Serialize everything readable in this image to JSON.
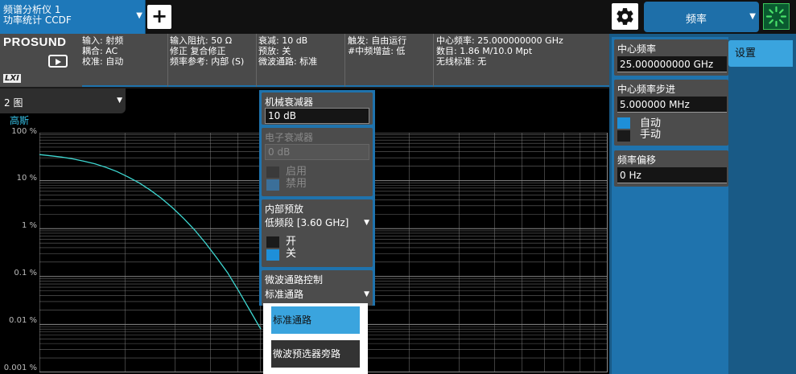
{
  "top_bar": {
    "app_tab": {
      "line1": "频谱分析仪 1",
      "line2": "功率统计 CCDF"
    },
    "add_button_label": "+",
    "frequency_menu_label": "频率"
  },
  "info": {
    "brand": "PROSUND",
    "lxi": "LXI",
    "col1": [
      "输入: 射频",
      "耦合: AC",
      "校准: 自动"
    ],
    "col2": [
      "输入阻抗: 50 Ω",
      "修正 复合修正",
      "频率参考: 内部 (S)"
    ],
    "col3": [
      "衰减: 10 dB",
      "预放: 关",
      "微波通路: 标准"
    ],
    "col4": [
      "触发: 自由运行",
      "#中频增益: 低"
    ],
    "col5": [
      "中心频率: 25.000000000 GHz",
      "数目: 1.86 M/10.0 Mpt",
      "无线标准: 无"
    ]
  },
  "plot": {
    "view_select": "2 图",
    "trace_label": "高斯",
    "y_labels": [
      "100 %",
      "10 %",
      "1 %",
      "0.1 %",
      "0.01 %",
      "0.001 %"
    ],
    "colors": {
      "curve": "#3ed8d2",
      "grid": "#8a8a8a"
    }
  },
  "chart_data": {
    "type": "line",
    "title": "",
    "xlabel": "",
    "ylabel": "",
    "y_scale": "log",
    "ylim": [
      0.001,
      100
    ],
    "yticks": [
      "100 %",
      "10 %",
      "1 %",
      "0.1 %",
      "0.01 %",
      "0.001 %"
    ],
    "grid": true,
    "series": [
      {
        "x": [
          0,
          0.05,
          0.1,
          0.15,
          0.2,
          0.25,
          0.3,
          0.35,
          0.4,
          0.45,
          0.5,
          0.55,
          0.6,
          0.65,
          0.7,
          0.75,
          0.8,
          0.85,
          0.9,
          0.95,
          1.0
        ],
        "y": [
          35,
          33,
          31,
          28.5,
          25.5,
          22.5,
          19,
          15.5,
          12,
          9,
          6.4,
          4.3,
          2.75,
          1.65,
          0.95,
          0.5,
          0.25,
          0.12,
          0.05,
          0.02,
          0.008
        ]
      }
    ]
  },
  "atten_panel": {
    "mech": {
      "title": "机械衰减器",
      "value": "10 dB"
    },
    "elec": {
      "title": "电子衰减器",
      "value": "0 dB",
      "opt_on": "启用",
      "opt_off": "禁用"
    },
    "preamp": {
      "title": "内部预放",
      "value": "低频段 [3.60 GHz]",
      "opt_on": "开",
      "opt_off": "关"
    },
    "mw_path": {
      "title": "微波通路控制",
      "value": "标准通路"
    }
  },
  "path_list": {
    "options": [
      "标准通路",
      "微波预选器旁路"
    ],
    "selected": 0
  },
  "right_panel": {
    "settings_tab": "设置",
    "center_freq": {
      "title": "中心频率",
      "value": "25.000000000 GHz"
    },
    "center_step": {
      "title": "中心频率步进",
      "value": "5.000000 MHz",
      "opt_auto": "自动",
      "opt_manual": "手动"
    },
    "freq_offset": {
      "title": "频率偏移",
      "value": "0 Hz"
    }
  }
}
